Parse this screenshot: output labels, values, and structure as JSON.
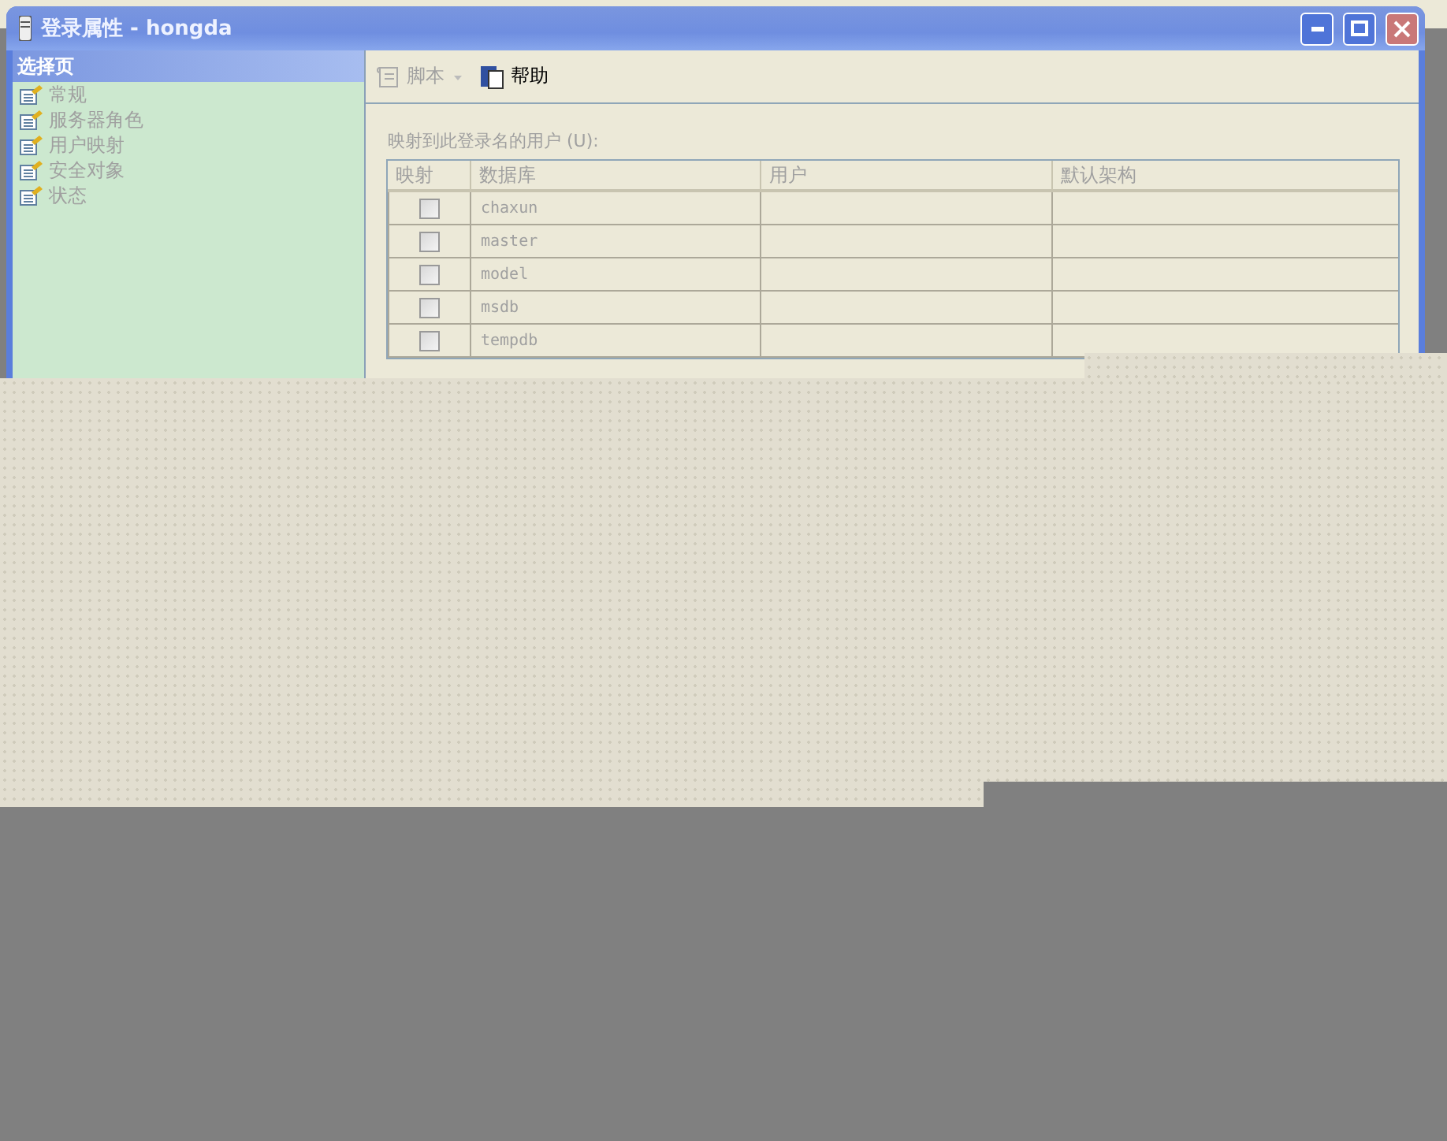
{
  "window": {
    "title": "登录属性 - hongda"
  },
  "sidebar": {
    "title": "选择页",
    "items": [
      {
        "label": "常规"
      },
      {
        "label": "服务器角色"
      },
      {
        "label": "用户映射"
      },
      {
        "label": "安全对象"
      },
      {
        "label": "状态"
      }
    ]
  },
  "toolbar": [
    {
      "label": "脚本",
      "disabled": true,
      "kind": "script"
    },
    {
      "label": "帮助",
      "disabled": false,
      "kind": "help"
    }
  ],
  "grid_label": "映射到此登录名的用户 (U):",
  "table": {
    "columns": [
      "映射",
      "数据库",
      "用户",
      "默认架构"
    ],
    "rows": [
      {
        "checked": false,
        "database": "chaxun",
        "user": "",
        "schema": ""
      },
      {
        "checked": false,
        "database": "master",
        "user": "",
        "schema": ""
      },
      {
        "checked": false,
        "database": "model",
        "user": "",
        "schema": ""
      },
      {
        "checked": false,
        "database": "msdb",
        "user": "",
        "schema": ""
      },
      {
        "checked": false,
        "database": "tempdb",
        "user": "",
        "schema": ""
      }
    ]
  }
}
